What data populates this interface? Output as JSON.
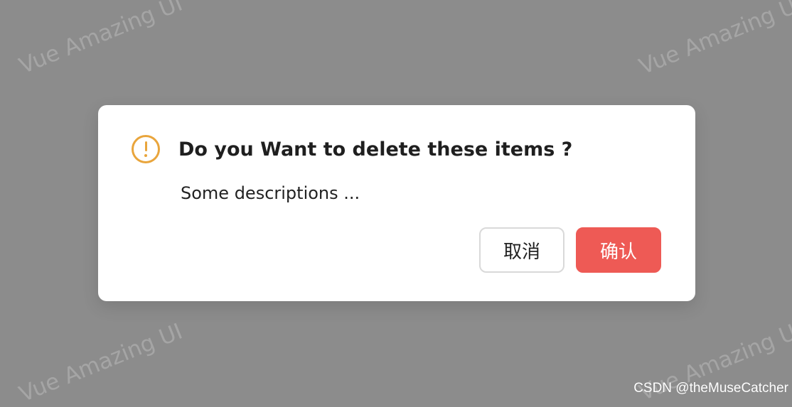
{
  "watermark": {
    "text": "Vue Amazing UI"
  },
  "dialog": {
    "icon": "exclamation-circle-icon",
    "title": "Do you Want to delete these items ?",
    "description": "Some descriptions ...",
    "cancel_label": "取消",
    "confirm_label": "确认"
  },
  "colors": {
    "overlay": "#8c8c8c",
    "warning": "#e9a53c",
    "confirm": "#ee5a55",
    "cancel_border": "#d9d9d9"
  },
  "credit": {
    "text": "CSDN @theMuseCatcher"
  }
}
